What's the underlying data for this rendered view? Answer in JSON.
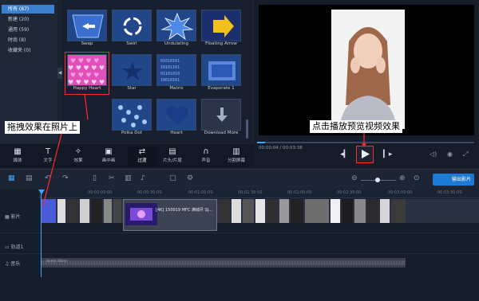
{
  "sidebar": {
    "items": [
      {
        "label": "所有 (87)",
        "selected": true
      },
      {
        "label": "新建 (20)",
        "selected": false
      },
      {
        "label": "通用 (59)",
        "selected": false
      },
      {
        "label": "时尚 (8)",
        "selected": false
      },
      {
        "label": "收藏夹 (0)",
        "selected": false
      }
    ]
  },
  "transitions": [
    {
      "label": "Swap",
      "icon": "swap-arrow-icon"
    },
    {
      "label": "Swirl",
      "icon": "recycle-icon"
    },
    {
      "label": "Undulating",
      "icon": "burst-icon"
    },
    {
      "label": "Floating Arrow",
      "icon": "arrow-icon"
    },
    {
      "label": "Happy Heart",
      "icon": "hearts-icon"
    },
    {
      "label": "Star",
      "icon": "star-icon"
    },
    {
      "label": "Matrix",
      "icon": "binary-icon"
    },
    {
      "label": "Evaporate 1",
      "icon": "evaporate-icon"
    },
    {
      "label": "Polka Dot",
      "icon": "dots-icon"
    },
    {
      "label": "Heart",
      "icon": "heart-icon"
    },
    {
      "label": "Download More",
      "icon": "download-icon"
    }
  ],
  "tabs": [
    {
      "label": "媒体",
      "icon": "media-icon"
    },
    {
      "label": "文字",
      "icon": "text-icon"
    },
    {
      "label": "效果",
      "icon": "effects-icon"
    },
    {
      "label": "画中画",
      "icon": "pip-icon"
    },
    {
      "label": "过渡",
      "icon": "transition-icon",
      "selected": true
    },
    {
      "label": "片头/片尾",
      "icon": "titles-icon"
    },
    {
      "label": "声音",
      "icon": "headphones-icon"
    },
    {
      "label": "分割屏幕",
      "icon": "split-screen-icon"
    }
  ],
  "player": {
    "timecode": "00:00:04 / 00:03:38",
    "progress": 0.04
  },
  "toolbar": {
    "export_label": "输出影片"
  },
  "ruler": {
    "ticks": [
      "00:00:00:00",
      "00:00:30:00",
      "00:01:00:00",
      "00:01:30:00",
      "00:02:00:00",
      "00:02:30:00",
      "00:03:00:00",
      "00:03:30:00"
    ]
  },
  "tracks": {
    "video": "影片",
    "track1": "轨道1",
    "music": "音乐"
  },
  "clip": {
    "title": "[4K] 150919 MFC 满城尽 SJ..."
  },
  "audio": {
    "title": "Some Story"
  },
  "annotations": {
    "drag": "拖拽效果在照片上",
    "play": "点击播放预览视频效果"
  },
  "colors": {
    "accent": "#1e7ad6",
    "selection": "#3a7fd0",
    "annotation_border": "#ff2a2a"
  }
}
